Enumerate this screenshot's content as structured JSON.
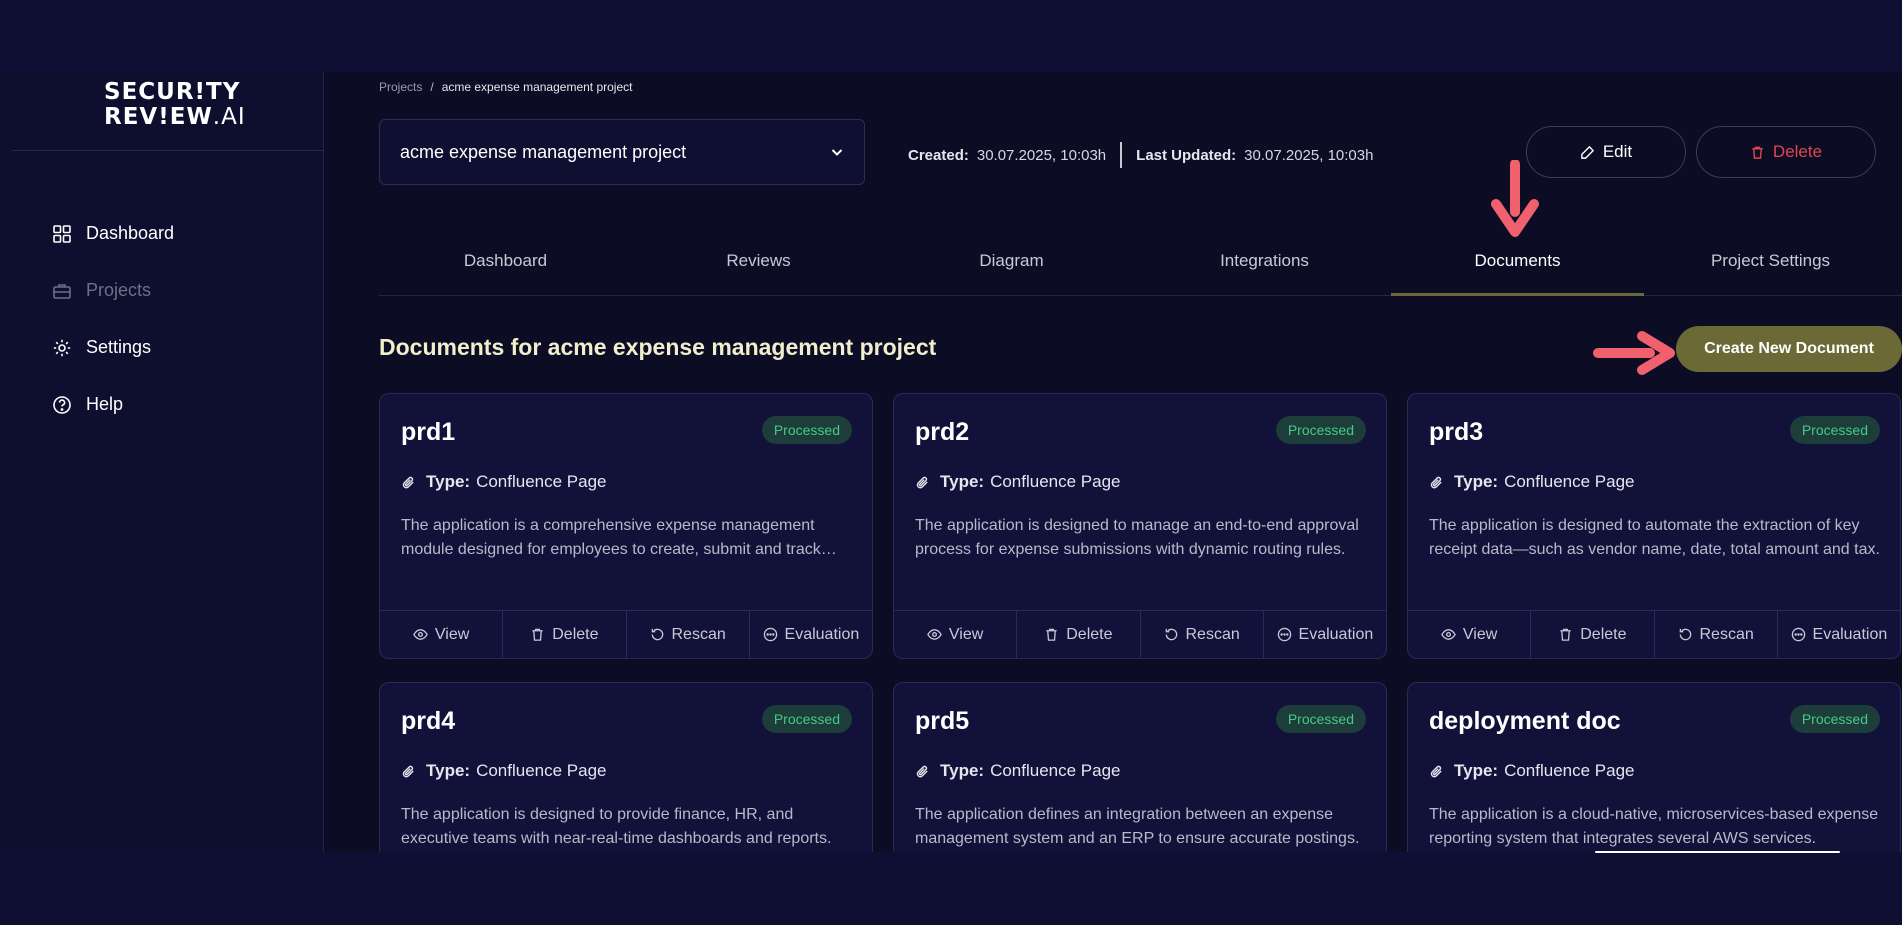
{
  "logo": {
    "line1": "SECUR!TY",
    "line2_bold": "REV!EW",
    "line2_light": ".AI"
  },
  "sidebar": {
    "items": [
      {
        "label": "Dashboard",
        "icon": "grid-icon",
        "muted": false
      },
      {
        "label": "Projects",
        "icon": "briefcase-icon",
        "muted": true
      },
      {
        "label": "Settings",
        "icon": "gear-icon",
        "muted": false
      },
      {
        "label": "Help",
        "icon": "help-circle-icon",
        "muted": false
      }
    ]
  },
  "breadcrumb": {
    "root": "Projects",
    "separator": "/",
    "current": "acme expense management project"
  },
  "project_select": {
    "value": "acme expense management project"
  },
  "meta": {
    "created_label": "Created:",
    "created_value": "30.07.2025, 10:03h",
    "updated_label": "Last Updated:",
    "updated_value": "30.07.2025, 10:03h"
  },
  "buttons": {
    "edit": "Edit",
    "delete": "Delete",
    "create": "Create New Document"
  },
  "tabs": [
    {
      "label": "Dashboard",
      "active": false
    },
    {
      "label": "Reviews",
      "active": false
    },
    {
      "label": "Diagram",
      "active": false
    },
    {
      "label": "Integrations",
      "active": false
    },
    {
      "label": "Documents",
      "active": true
    },
    {
      "label": "Project Settings",
      "active": false
    }
  ],
  "section_title": "Documents for acme expense management project",
  "card_labels": {
    "type": "Type:",
    "view": "View",
    "delete": "Delete",
    "rescan": "Rescan",
    "evaluation": "Evaluation"
  },
  "documents": [
    {
      "title": "prd1",
      "status": "Processed",
      "type": "Confluence Page",
      "description": "The application is a comprehensive expense management module designed for employees to create, submit and track expense reports."
    },
    {
      "title": "prd2",
      "status": "Processed",
      "type": "Confluence Page",
      "description": "The application is designed to manage an end-to-end approval process for expense submissions with dynamic routing rules."
    },
    {
      "title": "prd3",
      "status": "Processed",
      "type": "Confluence Page",
      "description": "The application is designed to automate the extraction of key receipt data—such as vendor name, date, total amount and tax."
    },
    {
      "title": "prd4",
      "status": "Processed",
      "type": "Confluence Page",
      "description": "The application is designed to provide finance, HR, and executive teams with near-real-time dashboards and reports."
    },
    {
      "title": "prd5",
      "status": "Processed",
      "type": "Confluence Page",
      "description": "The application defines an integration between an expense management system and an ERP to ensure accurate postings."
    },
    {
      "title": "deployment doc",
      "status": "Processed",
      "type": "Confluence Page",
      "description": "The application is a cloud-native, microservices-based expense reporting system that integrates several AWS services."
    }
  ],
  "colors": {
    "accent": "#6b6a36",
    "badge_text": "#46c98a",
    "danger": "#e0464f",
    "annotation": "#f0616d"
  }
}
